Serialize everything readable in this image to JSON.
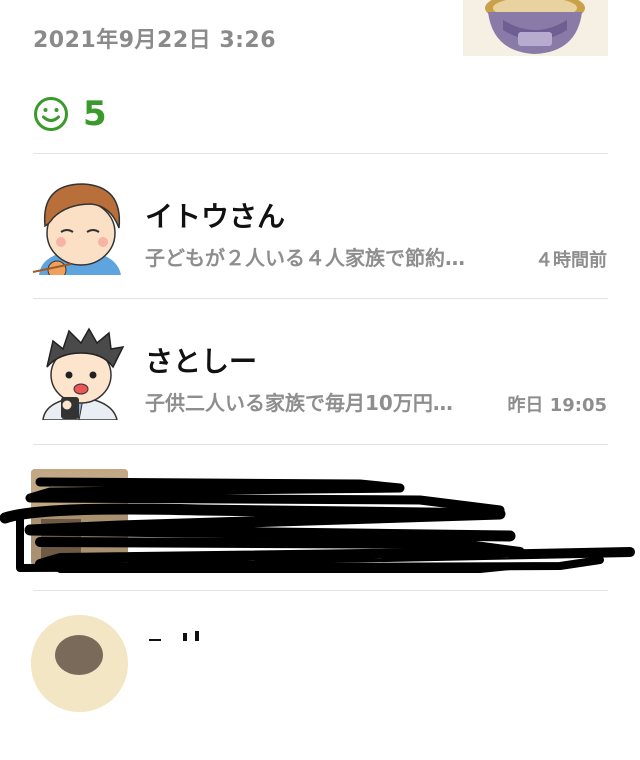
{
  "post": {
    "timestamp": "2021年9月22日 3:26",
    "reaction_icon": "smile-icon",
    "reaction_count": "5",
    "accent_color": "#3a9a2b"
  },
  "comments": [
    {
      "name": "イトウさん",
      "preview": "子どもが２人いる４人家族で節約…",
      "time": "４時間前",
      "avatar_icon": "illustrated-avatar-woman-icon"
    },
    {
      "name": "さとしー",
      "preview": "子供二人いる家族で毎月10万円…",
      "time": "昨日 19:05",
      "avatar_icon": "illustrated-avatar-man-icon"
    },
    {
      "name": "",
      "preview": "",
      "time": "",
      "avatar_icon": "photo-avatar-icon",
      "redacted": true
    },
    {
      "name": "",
      "avatar_icon": "illustrated-avatar-icon"
    }
  ]
}
